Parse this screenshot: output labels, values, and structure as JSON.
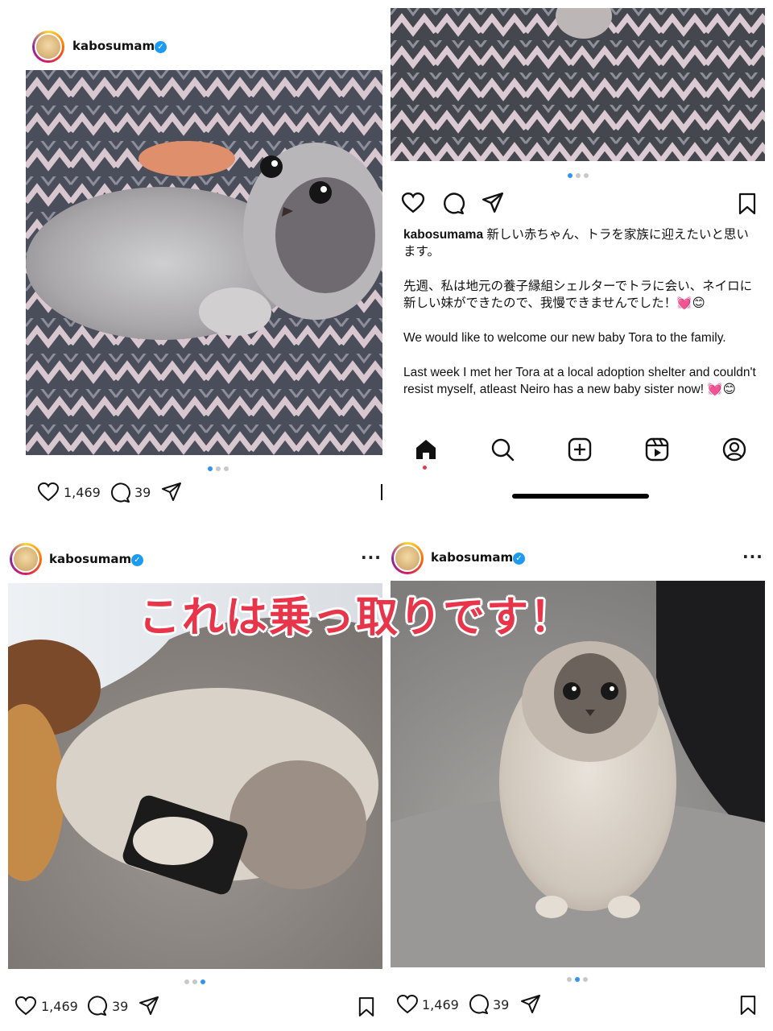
{
  "overlay_text": "これは乗っ取りです！",
  "posts": {
    "top_left": {
      "username": "kabosumama",
      "likes": "1,469",
      "comments": "39"
    },
    "top_right": {
      "caption": {
        "username": "kabosumama",
        "jp_line1": "新しい赤ちゃん、トラを家族に迎えたいと思います。",
        "jp_para2": "先週、私は地元の養子縁組シェルターでトラに会い、ネイロに新しい妹ができたので、我慢できませんでした！💓😊",
        "en_para1": "We would like to welcome our new baby Tora to the family.",
        "en_para2": "Last week I met her Tora at a local adoption shelter and couldn't resist myself, atleast Neiro has a new baby sister now! 💓😊"
      }
    },
    "bottom_left": {
      "username": "kabosumama",
      "likes": "1,469",
      "comments": "39"
    },
    "bottom_right": {
      "username": "kabosumama",
      "likes": "1,469",
      "comments": "39"
    }
  },
  "icons": {
    "verified": "verified-badge-icon",
    "heart": "heart-icon",
    "comment": "comment-icon",
    "share": "share-icon",
    "bookmark": "bookmark-icon",
    "more": "more-options-icon",
    "nav": [
      "home-icon",
      "search-icon",
      "create-icon",
      "reels-icon",
      "profile-icon"
    ]
  },
  "colors": {
    "verified": "#1d9bf0",
    "overlay_text": "#e8354a",
    "carousel_active": "#2f95f2"
  }
}
